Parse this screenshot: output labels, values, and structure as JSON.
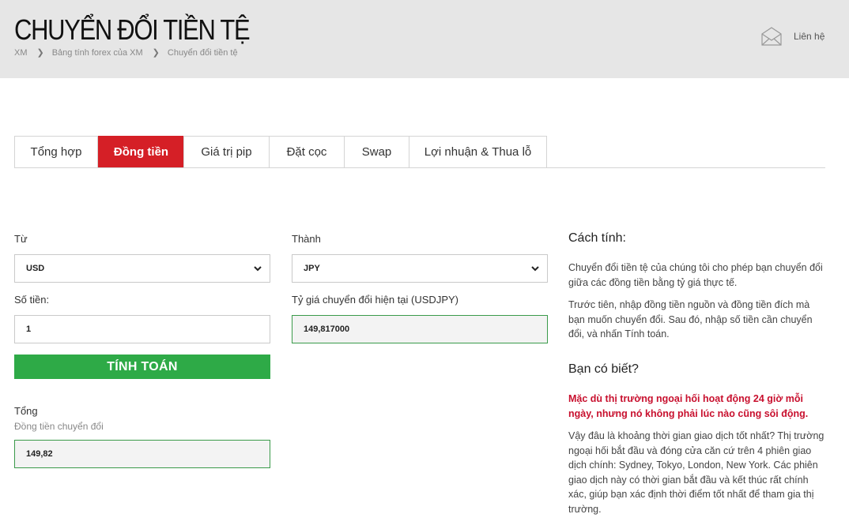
{
  "header": {
    "title": "CHUYỂN ĐỔI TIỀN TỆ",
    "breadcrumb": [
      "XM",
      "Bảng tính forex của XM",
      "Chuyển đổi tiền tệ"
    ],
    "contact_label": "Liên hệ"
  },
  "tabs": [
    "Tổng hợp",
    "Đồng tiền",
    "Giá trị pip",
    "Đặt cọc",
    "Swap",
    "Lợi nhuận & Thua lỗ"
  ],
  "active_tab": "Đồng tiền",
  "form": {
    "from_label": "Từ",
    "from_value": "USD",
    "to_label": "Thành",
    "to_value": "JPY",
    "amount_label": "Số tiền:",
    "amount_value": "1",
    "rate_label": "Tỷ giá chuyển đổi hiện tại (USDJPY)",
    "rate_value": "149,817000",
    "calculate_label": "TÍNH TOÁN",
    "total_label": "Tổng",
    "total_sublabel": "Đồng tiền chuyển đổi",
    "total_value": "149,82"
  },
  "side": {
    "how_title": "Cách tính:",
    "how_p1": "Chuyển đổi tiền tệ của chúng tôi cho phép bạn chuyển đổi giữa các đồng tiền bằng tỷ giá thực tế.",
    "how_p2": "Trước tiên, nhập đồng tiền nguồn và đồng tiền đích mà bạn muốn chuyển đổi. Sau đó, nhập số tiền cần chuyển đổi, và nhấn Tính toán.",
    "did_title": "Bạn có biết?",
    "did_highlight": "Mặc dù thị trường ngoại hối hoạt động 24 giờ mỗi ngày, nhưng nó không phải lúc nào cũng sôi động.",
    "did_p1": "Vậy đâu là khoảng thời gian giao dịch tốt nhất? Thị trường ngoại hối bắt đầu và đóng cửa căn cứ trên 4 phiên giao dịch chính: Sydney, Tokyo, London, New York. Các phiên giao dịch này có thời gian bắt đầu và kết thúc rất chính xác, giúp bạn xác định thời điểm tốt nhất để tham gia thị trường."
  },
  "colors": {
    "accent": "#d51f26",
    "button": "#2eaa47",
    "header_bg": "#e6e6e6"
  },
  "icons": {
    "contact": "envelope-icon",
    "select": "chevron-down-icon",
    "breadcrumb_sep": "chevron-right-icon"
  }
}
